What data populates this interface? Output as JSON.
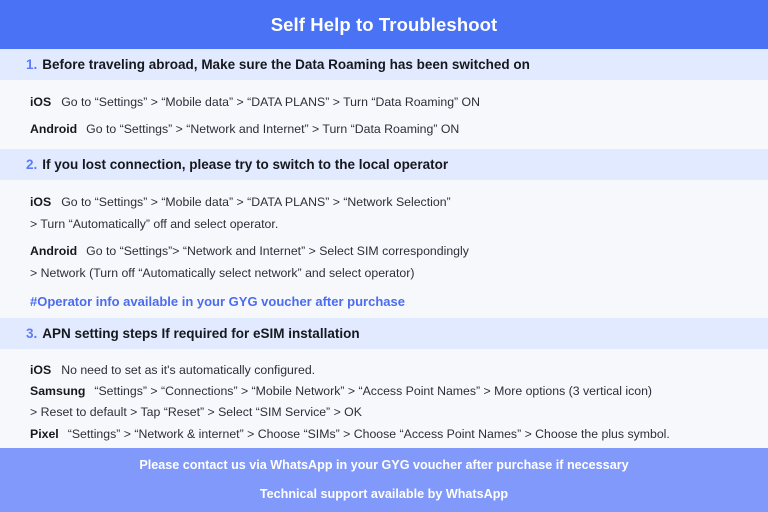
{
  "colors": {
    "header_bg": "#4a72f5",
    "band_bg": "#e2eaff",
    "page_bg": "#f7f8fc",
    "footer_bg": "#8199fa",
    "accent_blue": "#5b7cf6",
    "note_blue": "#4a6cf0",
    "body_text": "#2b2f38"
  },
  "header": {
    "title": "Self Help to Troubleshoot"
  },
  "sections": [
    {
      "number": "1.",
      "title_bold": "Before traveling abroad,",
      "title_rest": " Make sure the Data Roaming has been switched on",
      "steps": [
        {
          "os": "iOS",
          "text": "Go to “Settings” > “Mobile data” > “DATA PLANS” > Turn “Data Roaming” ON"
        },
        {
          "os": "Android",
          "text": "Go to “Settings” > “Network and Internet” > Turn “Data Roaming” ON"
        }
      ]
    },
    {
      "number": "2.",
      "title_bold": "If you lost connection, please try to switch to the local operator",
      "title_rest": "",
      "steps": [
        {
          "os": "iOS",
          "text": "Go to “Settings” > “Mobile data” > “DATA PLANS” > “Network Selection”",
          "continuation": "> Turn “Automatically” off and select operator."
        },
        {
          "os": "Android",
          "text": "Go to “Settings”>  “Network and Internet” > Select SIM correspondingly",
          "continuation": "> Network (Turn off “Automatically select network” and select operator)"
        }
      ],
      "note": "#Operator info available in your GYG voucher after purchase"
    },
    {
      "number": "3.",
      "title_bold": "APN setting steps If required for eSIM installation",
      "title_rest": "",
      "steps": [
        {
          "os": "iOS",
          "text": "No need to set as it's automatically configured."
        },
        {
          "os": "Samsung",
          "text": "“Settings” > “Connections” > “Mobile Network” > “Access Point Names” > More options (3 vertical icon)",
          "continuation": "> Reset to default > Tap “Reset” > Select “SIM Service” > OK"
        },
        {
          "os": "Pixel",
          "text": "“Settings” > “Network & internet” > Choose “SIMs” > Choose “Access Point Names” > Choose the plus symbol."
        }
      ]
    }
  ],
  "footer": {
    "line1": "Please contact us via WhatsApp  in your GYG voucher after purchase if necessary",
    "line2": "Technical support available by WhatsApp"
  }
}
